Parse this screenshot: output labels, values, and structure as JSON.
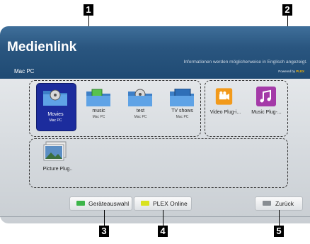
{
  "header": {
    "title": "Medienlink",
    "note": "Informationen werden möglicherweise in Englisch angezeigt.",
    "server": "Mac PC",
    "powered_prefix": "Powered by",
    "powered_brand": "PLEX"
  },
  "tiles": [
    {
      "label": "Movies",
      "sub": "Mac PC",
      "selected": true,
      "icon": "movies-folder-icon"
    },
    {
      "label": "music",
      "sub": "Mac PC",
      "icon": "music-folder-icon"
    },
    {
      "label": "test",
      "sub": "Mac PC",
      "icon": "test-folder-icon"
    },
    {
      "label": "TV shows",
      "sub": "Mac PC",
      "icon": "tv-folder-icon"
    },
    {
      "label": "Video Plug-i...",
      "icon": "video-plugin-icon"
    },
    {
      "label": "Music Plug-...",
      "icon": "music-plugin-icon"
    },
    {
      "label": "Picture Plug..",
      "icon": "picture-plugin-icon"
    }
  ],
  "buttons": {
    "device": "Geräteauswahl",
    "plex": "PLEX Online",
    "back": "Zurück"
  },
  "callouts": [
    "1",
    "2",
    "3",
    "4",
    "5"
  ],
  "colors": {
    "green_key": "#3db54a",
    "yellow_key": "#d9e21f",
    "selected": "#1c2c9d"
  }
}
